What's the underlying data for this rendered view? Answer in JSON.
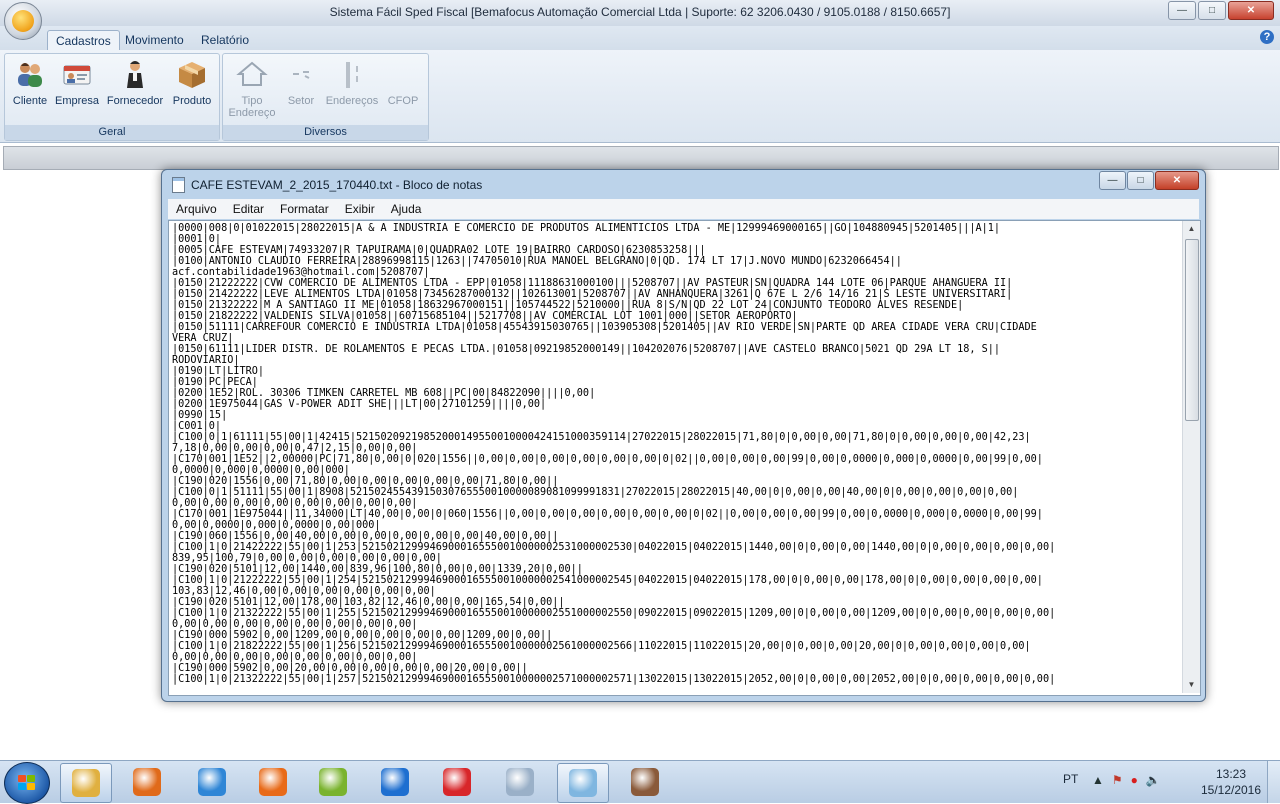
{
  "app": {
    "title": "Sistema Fácil Sped Fiscal [Bemafocus Automação Comercial Ltda | Suporte: 62 3206.0430 / 9105.0188 / 8150.6657]"
  },
  "ribbon": {
    "tabs": [
      {
        "label": "Cadastros"
      },
      {
        "label": "Movimento"
      },
      {
        "label": "Relatório"
      }
    ],
    "groups": {
      "geral": {
        "label": "Geral",
        "buttons": [
          {
            "label": "Cliente",
            "icon": "users-icon"
          },
          {
            "label": "Empresa",
            "icon": "id-card-icon"
          },
          {
            "label": "Fornecedor",
            "icon": "supplier-person-icon"
          },
          {
            "label": "Produto",
            "icon": "box-icon"
          }
        ]
      },
      "diversos": {
        "label": "Diversos",
        "buttons": [
          {
            "label": "Tipo Endereço",
            "line1": "Tipo",
            "line2": "Endereço",
            "icon": "house-icon"
          },
          {
            "label": "Setor",
            "icon": "sector-icon"
          },
          {
            "label": "Endereços",
            "icon": "address-icon"
          },
          {
            "label": "CFOP",
            "icon": "cfop-icon"
          }
        ]
      }
    }
  },
  "notepad": {
    "title": "CAFE ESTEVAM_2_2015_170440.txt - Bloco de notas",
    "menu": [
      "Arquivo",
      "Editar",
      "Formatar",
      "Exibir",
      "Ajuda"
    ],
    "content": "|0000|008|0|01022015|28022015|A & A INDUSTRIA E COMERCIO DE PRODUTOS ALIMENTICIOS LTDA - ME|12999469000165||GO|104880945|5201405|||A|1|\n|0001|0|\n|0005|CAFE ESTEVAM|74933207|R TAPUIRAMA|0|QUADRA02 LOTE 19|BAIRRO CARDOSO|6230853258|||\n|0100|ANTONIO CLAUDIO FERREIRA|28896998115|1263||74705010|RUA MANOEL BELGRANO|0|QD. 174 LT 17|J.NOVO MUNDO|6232066454||\nacf.contabilidade1963@hotmail.com|5208707|\n|0150|21222222|CVW COMERCIO DE ALIMENTOS LTDA - EPP|01058|11188631000100|||5208707||AV PASTEUR|SN|QUADRA 144 LOTE 06|PARQUE AHANGUERA II|\n|0150|21422222|LEVE ALIMENTOS LTDA|01058|73456287000132||102613001|5208707||AV ANHANQUERA|3261|Q 67E L 2/6 14/16 21|S LESTE UNIVERSITARI|\n|0150|21322222|M A SANTIAGO II ME|01058|18632967000151||105744522|5210000||RUA 8|S/N|QD 22 LOT 24|CONJUNTO TEODORO ALVES RESENDE|\n|0150|21822222|VALDENIS SILVA|01058||60715685104||5217708||AV COMERCIAL LOT 1001|000||SETOR AEROPORTO|\n|0150|51111|CARREFOUR COMERCIO E INDUSTRIA LTDA|01058|45543915030765||103905308|5201405||AV RIO VERDE|SN|PARTE QD AREA CIDADE VERA CRU|CIDADE\nVERA CRUZ|\n|0150|61111|LIDER DISTR. DE ROLAMENTOS E PECAS LTDA.|01058|09219852000149||104202076|5208707||AVE CASTELO BRANCO|5021 QD 29A LT 18, S||\nRODOVIARIO|\n|0190|LT|LITRO|\n|0190|PC|PECA|\n|0200|1E52|ROL. 30306 TIMKEN CARRETEL MB 608||PC|00|84822090||||0,00|\n|0200|1E975044|GAS V-POWER ADIT SHE|||LT|00|27101259||||0,00|\n|0990|15|\n|C001|0|\n|C100|0|1|61111|55|00|1|42415|52150209219852000149550010000424151000359114|27022015|28022015|71,80|0|0,00|0,00|71,80|0|0,00|0,00|0,00|42,23|\n7,18|0,00|0,00|0,00|0,47|2,15|0,00|0,00|\n|C170|001|1E52||2,00000|PC|71,80|0,00|0|020|1556||0,00|0,00|0,00|0,00|0,00|0,00|0|02||0,00|0,00|0,00|99|0,00|0,0000|0,000|0,0000|0,00|99|0,00|\n0,0000|0,000|0,0000|0,00|000|\n|C190|020|1556|0,00|71,80|0,00|0,00|0,00|0,00|0,00|71,80|0,00||\n|C100|0|1|51111|55|00|1|8908|52150245543915030765550010000089081099991831|27022015|28022015|40,00|0|0,00|0,00|40,00|0|0,00|0,00|0,00|0,00|\n0,00|0,00|0,00|0,00|0,00|0,00|0,00|0,00|\n|C170|001|1E975044||11,34000|LT|40,00|0,00|0|060|1556||0,00|0,00|0,00|0,00|0,00|0,00|0|02||0,00|0,00|0,00|99|0,00|0,0000|0,000|0,0000|0,00|99|\n0,00|0,0000|0,000|0,0000|0,00|000|\n|C190|060|1556|0,00|40,00|0,00|0,00|0,00|0,00|0,00|40,00|0,00||\n|C100|1|0|21422222|55|00|1|253|52150212999469000165550010000002531000002530|04022015|04022015|1440,00|0|0,00|0,00|1440,00|0|0,00|0,00|0,00|0,00|\n839,95|100,79|0,00|0,00|0,00|0,00|0,00|0,00|\n|C190|020|5101|12,00|1440,00|839,96|100,80|0,00|0,00|1339,20|0,00||\n|C100|1|0|21222222|55|00|1|254|52150212999469000165550010000002541000002545|04022015|04022015|178,00|0|0,00|0,00|178,00|0|0,00|0,00|0,00|0,00|\n103,83|12,46|0,00|0,00|0,00|0,00|0,00|0,00|\n|C190|020|5101|12,00|178,00|103,82|12,46|0,00|0,00|165,54|0,00||\n|C100|1|0|21322222|55|00|1|255|52150212999469000165550010000002551000002550|09022015|09022015|1209,00|0|0,00|0,00|1209,00|0|0,00|0,00|0,00|0,00|\n0,00|0,00|0,00|0,00|0,00|0,00|0,00|0,00|\n|C190|000|5902|0,00|1209,00|0,00|0,00|0,00|0,00|1209,00|0,00||\n|C100|1|0|21822222|55|00|1|256|52150212999469000165550010000002561000002566|11022015|11022015|20,00|0|0,00|0,00|20,00|0|0,00|0,00|0,00|0,00|\n0,00|0,00|0,00|0,00|0,00|0,00|0,00|0,00|\n|C190|000|5902|0,00|20,00|0,00|0,00|0,00|0,00|20,00|0,00||\n|C100|1|0|21322222|55|00|1|257|52150212999469000165550010000002571000002571|13022015|13022015|2052,00|0|0,00|0,00|2052,00|0|0,00|0,00|0,00|0,00|"
  },
  "taskbar": {
    "items": [
      {
        "icon": "folder-manager-icon",
        "color": "#e0b040"
      },
      {
        "icon": "media-player-icon",
        "color": "#e06a1a"
      },
      {
        "icon": "internet-explorer-icon",
        "color": "#2f86d6"
      },
      {
        "icon": "firefox-icon",
        "color": "#e86a18"
      },
      {
        "icon": "people-network-icon",
        "color": "#7ab32e"
      },
      {
        "icon": "teamviewer-icon",
        "color": "#1e6fd0"
      },
      {
        "icon": "bank-app-icon",
        "color": "#d8262a"
      },
      {
        "icon": "paint-icon",
        "color": "#9ab0c8"
      },
      {
        "icon": "notepad-icon",
        "color": "#7fb6e0"
      },
      {
        "icon": "books-icon",
        "color": "#8a5a3a"
      }
    ],
    "language": "PT",
    "time": "13:23",
    "date": "15/12/2016"
  }
}
